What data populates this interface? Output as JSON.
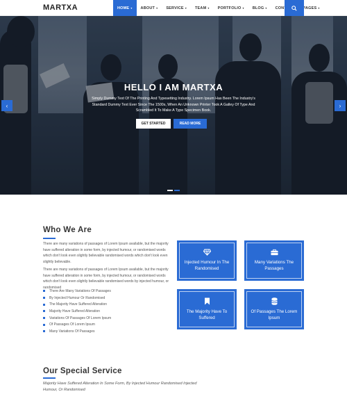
{
  "brand": "MARTXA",
  "nav": {
    "items": [
      {
        "label": "HOME",
        "active": true,
        "dropdown": true
      },
      {
        "label": "ABOUT",
        "dropdown": true
      },
      {
        "label": "SERVICE",
        "dropdown": true
      },
      {
        "label": "TEAM",
        "dropdown": true
      },
      {
        "label": "PORTFOLIO",
        "dropdown": true
      },
      {
        "label": "BLOG",
        "dropdown": true
      },
      {
        "label": "CONTACT",
        "dropdown": false
      },
      {
        "label": "PAGES",
        "dropdown": true
      }
    ],
    "search_icon": "search-icon"
  },
  "hero": {
    "title": "HELLO I AM MARTXA",
    "text": "Simply Dummy Text Of The Printing And Typesetting Industry. Lorem Ipsum Has Been The Industry's Standard Dummy Text Ever Since The 1500s, When An Unknown Printer Took A Galley Of Type And Scrambled It To Make A Type Specimen Book.",
    "primary_button": "GET STARTED",
    "secondary_button": "READ MORE",
    "prev_icon": "chevron-left-icon",
    "next_icon": "chevron-right-icon",
    "active_slide": 1
  },
  "about": {
    "title": "Who We Are",
    "paragraphs": [
      "There are many variations of passages of Lorem Ipsum available, but the majority have suffered alteration in some form, by injected humour, or randomised words which don't look even slightly believable randomised words which don't look even slightly believable.",
      "There are many variations of passages of Lorem Ipsum available, but the majority have suffered alteration in some form, by injected humour, or randomised words which don't look even slightly believable randomised words by injected humour, or randomised"
    ],
    "list": [
      "There Are Many Variations Of Passages",
      "By Injected Humour Or Randomised",
      "The Majority Have Suffered Alteration",
      "Majority Have Suffered Alteration",
      "Variations Of Passages Of Lorem Ipsum",
      "Of Passages Of Lorem Ipsum",
      "Many Variations Of Passages"
    ],
    "cards": [
      {
        "icon": "diamond-icon",
        "title": "Injected Humour In The Randomised"
      },
      {
        "icon": "briefcase-icon",
        "title": "Many Variations The Passages"
      },
      {
        "icon": "bookmark-icon",
        "title": "The Majority Have To Suffered"
      },
      {
        "icon": "database-icon",
        "title": "Of Passages The Lorem Ipsum"
      }
    ]
  },
  "service": {
    "title": "Our Special Service",
    "text": "Majority Have Suffered Alteration In Some Form, By Injected Humour Randomised Injected Humour, Or Randomised"
  },
  "colors": {
    "accent": "#2a6bd4",
    "hero_dark": "#1e2836"
  }
}
